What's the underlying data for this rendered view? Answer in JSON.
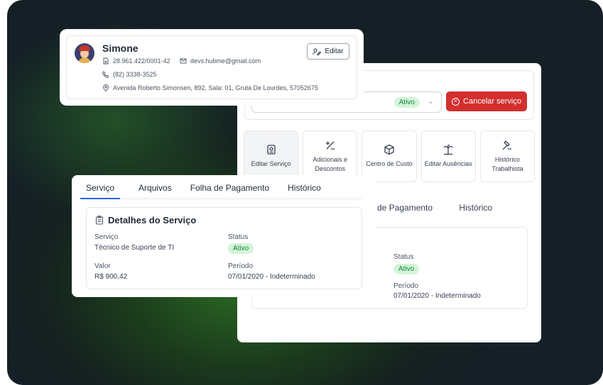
{
  "profile": {
    "name": "Simone",
    "cnpj": "28.961.422/0001-42",
    "email": "devs.hubme@gmail.com",
    "phone": "(82) 3338-3525",
    "address": "Avenida Roberto Simonsen, 892, Sala: 01, Gruta De Lourdes, 57052675",
    "edit_label": "Editar"
  },
  "back_panel": {
    "status_badge": "Ativo",
    "cancel_label": "Cancelar serviço",
    "tiles": [
      {
        "label": "Editar Serviço",
        "icon": "id-badge-icon"
      },
      {
        "label": "Adicionais e Descontos",
        "icon": "plus-minus-icon"
      },
      {
        "label": "Centro de Custo",
        "icon": "box-icon"
      },
      {
        "label": "Editar Ausências",
        "icon": "palm-tree-icon"
      },
      {
        "label": "Histórico Trabalhista",
        "icon": "gavel-icon"
      }
    ],
    "tabs_partial": [
      "de Pagamento",
      "Histórico"
    ],
    "status_label": "Status",
    "status_value": "Ativo",
    "period_label": "Período",
    "period_value": "07/01/2020 - Indeterminado"
  },
  "service": {
    "tabs": [
      "Serviço",
      "Arquivos",
      "Folha de Pagamento",
      "Histórico"
    ],
    "title": "Detalhes do Serviço",
    "servico_label": "Serviço",
    "servico_value": "Técnico de Suporte de TI",
    "status_label": "Status",
    "status_value": "Ativo",
    "valor_label": "Valor",
    "valor_value": "R$ 900,42",
    "periodo_label": "Período",
    "periodo_value": "07/01/2020 - Indeterminado"
  },
  "colors": {
    "accent": "#2563eb",
    "danger": "#d32f2f",
    "success_bg": "#d3f5d8",
    "success_text": "#15803d"
  }
}
